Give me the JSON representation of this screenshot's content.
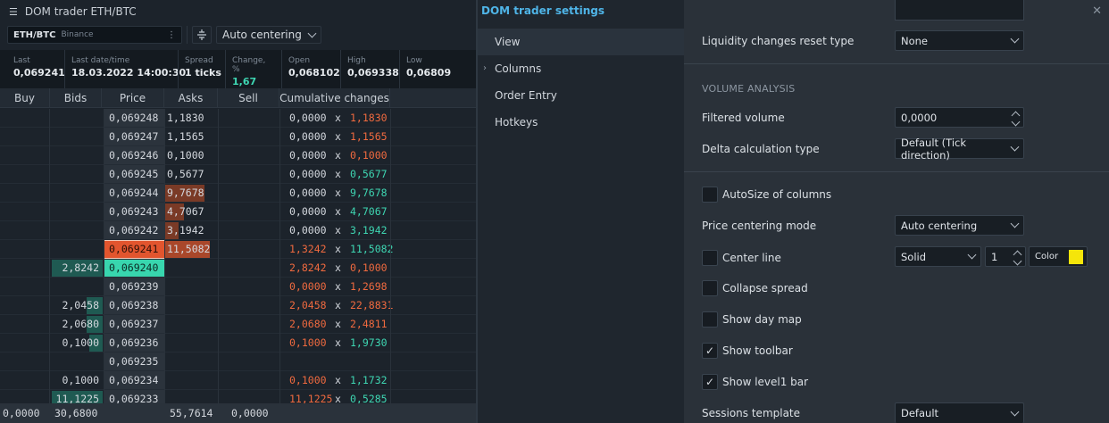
{
  "window": {
    "title": "DOM trader ETH/BTC"
  },
  "toolbar": {
    "symbol": "ETH/BTC",
    "exchange": "Binance",
    "centering": "Auto centering"
  },
  "level1": [
    {
      "label": "Last",
      "value": "0,069241",
      "color": "#e4e8ec"
    },
    {
      "label": "Last date/time",
      "value": "18.03.2022 14:00:30",
      "color": "#e4e8ec"
    },
    {
      "label": "Spread",
      "value": "1 ticks",
      "color": "#e4e8ec"
    },
    {
      "label": "Change, %",
      "value": "1,67",
      "color": "#3ed6b2"
    },
    {
      "label": "Open",
      "value": "0,068102",
      "color": "#e4e8ec"
    },
    {
      "label": "High",
      "value": "0,069338",
      "color": "#e4e8ec"
    },
    {
      "label": "Low",
      "value": "0,06809",
      "color": "#e4e8ec"
    }
  ],
  "columns": [
    "Buy",
    "Bids",
    "Price",
    "Asks",
    "Sell",
    "Cumulative changes"
  ],
  "rows": [
    {
      "price": "0,069248",
      "ask": "1,1830",
      "bid": "",
      "cumL": "0,0000",
      "cumR": "1,1830",
      "cumLc": "w",
      "cumRc": "r",
      "askBar": 0
    },
    {
      "price": "0,069247",
      "ask": "1,1565",
      "bid": "",
      "cumL": "0,0000",
      "cumR": "1,1565",
      "cumLc": "w",
      "cumRc": "r",
      "askBar": 0
    },
    {
      "price": "0,069246",
      "ask": "0,1000",
      "bid": "",
      "cumL": "0,0000",
      "cumR": "0,1000",
      "cumLc": "w",
      "cumRc": "r",
      "askBar": 0
    },
    {
      "price": "0,069245",
      "ask": "0,5677",
      "bid": "",
      "cumL": "0,0000",
      "cumR": "0,5677",
      "cumLc": "w",
      "cumRc": "g",
      "askBar": 0
    },
    {
      "price": "0,069244",
      "ask": "9,7678",
      "bid": "",
      "cumL": "0,0000",
      "cumR": "9,7678",
      "cumLc": "w",
      "cumRc": "g",
      "askBar": 0.75
    },
    {
      "price": "0,069243",
      "ask": "4,7067",
      "bid": "",
      "cumL": "0,0000",
      "cumR": "4,7067",
      "cumLc": "w",
      "cumRc": "g",
      "askBar": 0.36
    },
    {
      "price": "0,069242",
      "ask": "3,1942",
      "bid": "",
      "cumL": "0,0000",
      "cumR": "3,1942",
      "cumLc": "w",
      "cumRc": "g",
      "askBar": 0.25
    },
    {
      "price": "0,069241",
      "ask": "11,5082",
      "bid": "",
      "cumL": "1,3242",
      "cumR": "11,5082",
      "cumLc": "r",
      "cumRc": "g",
      "askBar": 0.85,
      "bestAsk": true
    },
    {
      "price": "0,069240",
      "ask": "",
      "bid": "2,8242",
      "cumL": "2,8242",
      "cumR": "0,1000",
      "cumLc": "r",
      "cumRc": "r",
      "bidBar": 0.95,
      "bestBid": true
    },
    {
      "price": "0,069239",
      "ask": "",
      "bid": "",
      "cumL": "0,0000",
      "cumR": "1,2698",
      "cumLc": "r",
      "cumRc": "r",
      "bidBar": 0
    },
    {
      "price": "0,069238",
      "ask": "",
      "bid": "2,0458",
      "cumL": "2,0458",
      "cumR": "22,8831",
      "cumLc": "r",
      "cumRc": "r",
      "bidBar": 0.3
    },
    {
      "price": "0,069237",
      "ask": "",
      "bid": "2,0680",
      "cumL": "2,0680",
      "cumR": "2,4811",
      "cumLc": "r",
      "cumRc": "r",
      "bidBar": 0.3
    },
    {
      "price": "0,069236",
      "ask": "",
      "bid": "0,1000",
      "cumL": "0,1000",
      "cumR": "1,9730",
      "cumLc": "r",
      "cumRc": "g",
      "bidBar": 0.25
    },
    {
      "price": "0,069235",
      "ask": "",
      "bid": "",
      "cumL": "",
      "cumR": "",
      "cumLc": "w",
      "cumRc": "w",
      "bidBar": 0
    },
    {
      "price": "0,069234",
      "ask": "",
      "bid": "0,1000",
      "cumL": "0,1000",
      "cumR": "1,1732",
      "cumLc": "r",
      "cumRc": "g",
      "bidBar": 0
    },
    {
      "price": "0,069233",
      "ask": "",
      "bid": "11,1225",
      "cumL": "11,1225",
      "cumR": "0,5285",
      "cumLc": "r",
      "cumRc": "g",
      "bidBar": 0.95
    }
  ],
  "footer": {
    "buy": "0,0000",
    "bids": "30,6800",
    "asks": "55,7614",
    "sell": "0,0000"
  },
  "settings": {
    "title": "DOM trader settings",
    "nav": [
      "View",
      "Columns",
      "Order Entry",
      "Hotkeys"
    ],
    "liquidity_label": "Liquidity changes reset type",
    "liquidity_value": "None",
    "volume_section": "VOLUME ANALYSIS",
    "filtered_label": "Filtered volume",
    "filtered_value": "0,0000",
    "delta_label": "Delta calculation type",
    "delta_value": "Default (Tick direction)",
    "autosize_label": "AutoSize of columns",
    "centering_label": "Price centering mode",
    "centering_value": "Auto centering",
    "centerline_label": "Center line",
    "centerline_style": "Solid",
    "centerline_width": "1",
    "color_label": "Color",
    "color_value": "#f5e50a",
    "collapse_label": "Collapse spread",
    "daymap_label": "Show day map",
    "toolbar_label": "Show toolbar",
    "level1_label": "Show level1 bar",
    "sessions_label": "Sessions template",
    "sessions_value": "Default",
    "checks": {
      "autosize": false,
      "centerline": false,
      "collapse": false,
      "daymap": false,
      "toolbar": true,
      "level1": true
    }
  },
  "colors": {
    "red": "#f06a3f",
    "green": "#3ed6b2",
    "white": "#d4d8de",
    "askbar": "#7a3a26",
    "bidbar": "#1f5a52",
    "bestask": "#e2552e",
    "bestbid": "#38d6ae"
  }
}
